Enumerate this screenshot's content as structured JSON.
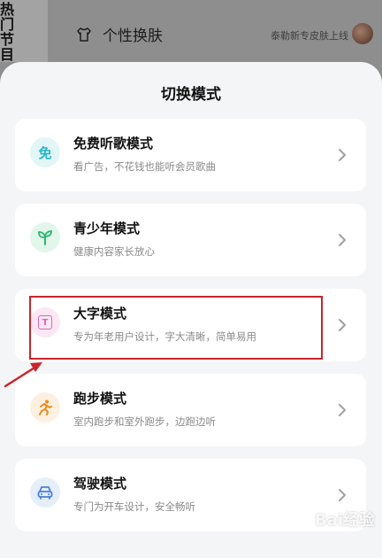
{
  "background": {
    "top_left_text": "热门节目",
    "top_left_sub": "节目",
    "skin_label": "个性换肤",
    "right_text": "泰勒新专皮肤上线"
  },
  "sheet": {
    "title": "切换模式",
    "items": [
      {
        "title": "免费听歌模式",
        "desc": "看广告，不花钱也能听会员歌曲",
        "icon": "free-icon",
        "icon_text": "免",
        "color": "#25b5c6",
        "bg": "#e2f6f8"
      },
      {
        "title": "青少年模式",
        "desc": "健康内容家长放心",
        "icon": "sprout-icon",
        "color": "#2bb673",
        "bg": "#e3f6ec"
      },
      {
        "title": "大字模式",
        "desc": "专为年老用户设计，字大清晰，简单易用",
        "icon": "text-size-icon",
        "icon_text": "T",
        "color": "#e065b4",
        "bg": "#fbe8f4"
      },
      {
        "title": "跑步模式",
        "desc": "室内跑步和室外跑步，边跑边听",
        "icon": "running-icon",
        "color": "#f08a1c",
        "bg": "#fdf0e0"
      },
      {
        "title": "驾驶模式",
        "desc": "专门为开车设计，安全畅听",
        "icon": "car-icon",
        "color": "#4a7fd8",
        "bg": "#e5eefb"
      }
    ]
  },
  "annotation": {
    "color": "#c8262a"
  },
  "watermark": "Bai经验"
}
